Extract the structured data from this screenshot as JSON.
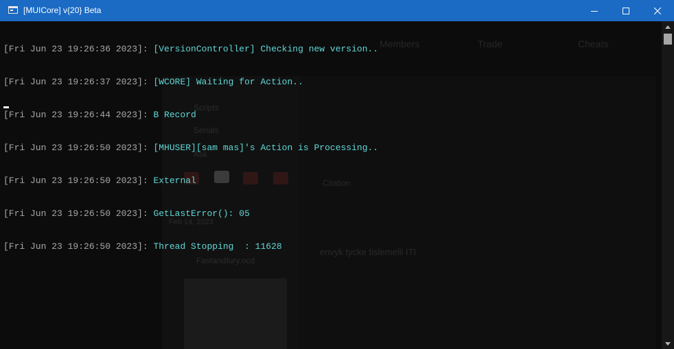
{
  "window": {
    "title": "[MUICore] v{20} Beta",
    "icon": "console-window-icon",
    "controls": [
      "minimize-icon",
      "maximize-icon",
      "close-icon"
    ]
  },
  "colors": {
    "titlebar": "#1b6ac4",
    "background": "#0c0c0c",
    "timestamp": "#a8a8a8",
    "message": "#61d6d6"
  },
  "console": {
    "lines": [
      {
        "timestamp": "[Fri Jun 23 19:26:36 2023]:",
        "message": "[VersionController] Checking new version.."
      },
      {
        "timestamp": "[Fri Jun 23 19:26:37 2023]:",
        "message": "[WCORE] Waiting for Action.."
      },
      {
        "timestamp": "[Fri Jun 23 19:26:44 2023]:",
        "message": "B Record"
      },
      {
        "timestamp": "[Fri Jun 23 19:26:50 2023]:",
        "message": "[MHUSER][sam mas]'s Action is Processing.."
      },
      {
        "timestamp": "[Fri Jun 23 19:26:50 2023]:",
        "message": "External"
      },
      {
        "timestamp": "[Fri Jun 23 19:26:50 2023]:",
        "message": "GetLastError(): 05"
      },
      {
        "timestamp": "[Fri Jun 23 19:26:50 2023]:",
        "message": "Thread Stopping  : 11628"
      }
    ]
  },
  "background_ghost": {
    "nav_members": "Members",
    "nav_trade": "Trade",
    "nav_cheats": "Cheats",
    "side_item_1": "Scripts",
    "side_item_2": "Serials",
    "side_item_3": "Ask",
    "date": "Feb 14, 2023",
    "username": "Fastandfury.ocd",
    "post_label": "Citation",
    "post_text": "envyk tycke tislemelli ITI"
  }
}
